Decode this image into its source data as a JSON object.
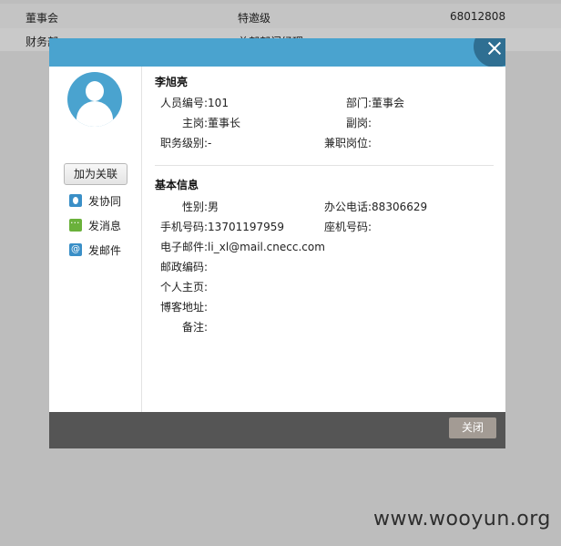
{
  "background_table": {
    "row1": {
      "dept": "董事会",
      "level": "特邀级",
      "phone": "68012808"
    },
    "row2": {
      "dept": "财务部",
      "level": "总部部门经理"
    }
  },
  "dialog": {
    "left": {
      "add_contact_label": "加为关联",
      "actions": [
        {
          "icon": "collaboration-icon",
          "label": "发协同"
        },
        {
          "icon": "message-icon",
          "label": "发消息"
        },
        {
          "icon": "email-icon",
          "label": "发邮件"
        }
      ]
    },
    "person": {
      "name": "李旭亮",
      "employee_no_label": "人员编号:",
      "employee_no": "101",
      "dept_label": "部门:",
      "dept": "董事会",
      "main_post_label": "主岗:",
      "main_post": "董事长",
      "deputy_post_label": "副岗:",
      "deputy_post": "",
      "level_label": "职务级别:",
      "level": "-",
      "concurrent_label": "兼职岗位:",
      "concurrent": ""
    },
    "basic": {
      "title": "基本信息",
      "gender_label": "性别:",
      "gender": "男",
      "office_phone_label": "办公电话:",
      "office_phone": "88306629",
      "mobile_label": "手机号码:",
      "mobile": "13701197959",
      "landline_label": "座机号码:",
      "landline": "",
      "email_label": "电子邮件:",
      "email": "li_xl@mail.cnecc.com",
      "postcode_label": "邮政编码:",
      "postcode": "",
      "homepage_label": "个人主页:",
      "homepage": "",
      "blog_label": "博客地址:",
      "blog": "",
      "remark_label": "备注:",
      "remark": ""
    },
    "footer": {
      "close_label": "关闭"
    }
  },
  "watermark": "www.wooyun.org"
}
